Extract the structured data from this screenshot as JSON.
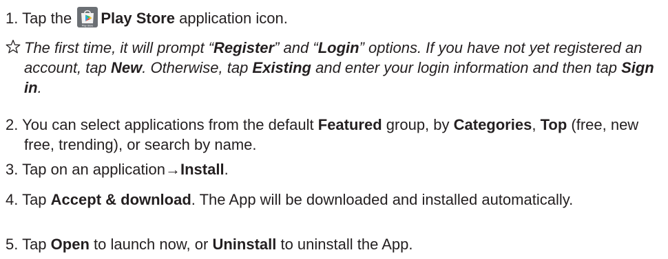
{
  "step1": {
    "num": "1. Tap the ",
    "bold": "Play Store",
    "rest": " application icon.",
    "icon_label": "Play Store"
  },
  "note": {
    "t1": "The first time, it will prompt “",
    "b1": "Register",
    "t2": "” and “",
    "b2": "Login",
    "t3": "” options. If you have not yet registered an account, tap ",
    "b3": "New",
    "t4": ". Otherwise, tap ",
    "b4": "Existing",
    "t5": " and enter your login information and then tap ",
    "b5": "Sign in",
    "t6": "."
  },
  "step2": {
    "t1": "2. You can select applications from the default ",
    "b1": "Featured",
    "t2": " group, by ",
    "b2": "Categories",
    "t3": ", ",
    "b3": "Top",
    "t4": " (free, new free, trending), or search by name."
  },
  "step3": {
    "t1": "3. Tap on an application→",
    "b1": "Install",
    "t2": "."
  },
  "step4": {
    "t1": "4. Tap ",
    "b1": "Accept & download",
    "t2": ". The App will be downloaded and installed automatically."
  },
  "step5": {
    "t1": "5. Tap ",
    "b1": "Open",
    "t2": " to launch now, or ",
    "b2": "Uninstall",
    "t3": " to uninstall the App."
  },
  "colors": {
    "text": "#231f20",
    "icon_bg": "#6b6f74",
    "icon_bag": "#f2f2f2",
    "play_green": "#3bb54a",
    "play_blue": "#2aa7e0",
    "play_yellow": "#f6c32a",
    "play_red": "#e64a3b"
  }
}
